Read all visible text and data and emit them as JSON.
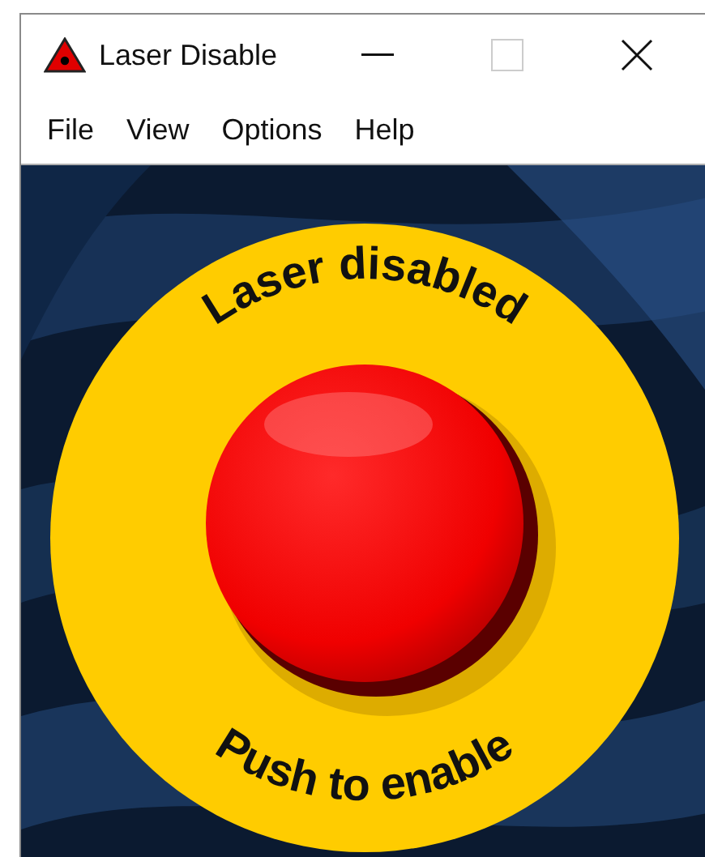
{
  "window": {
    "title": "Laser Disable",
    "controls": [
      {
        "kind": "minimize",
        "disabled": false
      },
      {
        "kind": "maximize",
        "disabled": true
      },
      {
        "kind": "close",
        "disabled": false
      }
    ]
  },
  "menu": [
    "File",
    "View",
    "Options",
    "Help"
  ],
  "panel": {
    "top_text": "Laser disabled",
    "bottom_text": "Push to enable"
  }
}
